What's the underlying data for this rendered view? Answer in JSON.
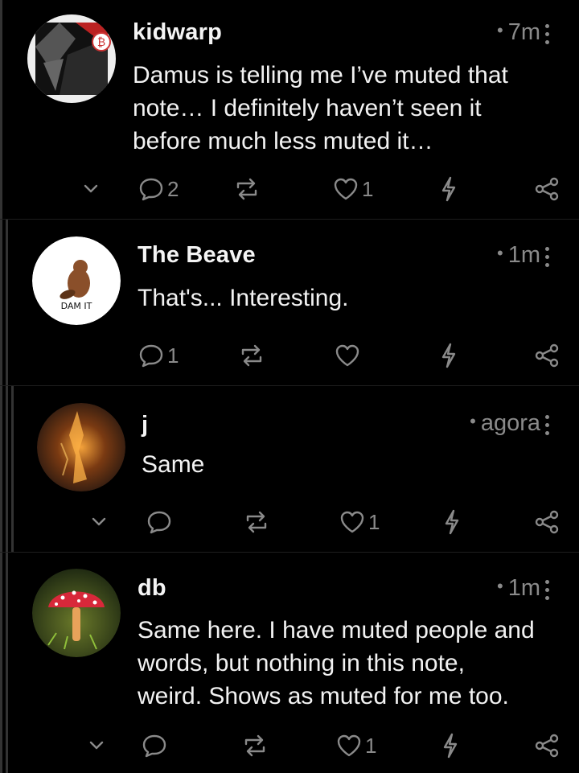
{
  "notes": [
    {
      "author": "kidwarp",
      "time": "7m",
      "dot": "•",
      "content_lines": [
        "Damus is telling me I’ve muted that",
        "note… I definitely haven’t seen it",
        "before much less muted it…"
      ],
      "replies": "2",
      "reposts": "",
      "likes": "1",
      "avatar_icon": "abstract-avatar-with-bitcoin-badge"
    },
    {
      "author": "The Beave",
      "time": "1m",
      "dot": "•",
      "content_lines": [
        "That's... Interesting."
      ],
      "replies": "1",
      "reposts": "",
      "likes": "",
      "avatar_icon": "beaver-logo",
      "avatar_text": "DAM IT"
    },
    {
      "author": "j",
      "time": "agora",
      "dot": "•",
      "content_lines": [
        "Same"
      ],
      "replies": "",
      "reposts": "",
      "likes": "1",
      "avatar_icon": "fire-avatar"
    },
    {
      "author": "db",
      "time": "1m",
      "dot": "•",
      "content_lines": [
        "Same here. I have muted people and",
        "words, but nothing in this note,",
        "weird. Shows as muted for me too."
      ],
      "replies": "",
      "reposts": "",
      "likes": "1",
      "avatar_icon": "mushroom-avatar"
    }
  ],
  "colors": {
    "background": "#000000",
    "text": "#f2f2f2",
    "muted": "#8a8a8a",
    "rail": "#333333"
  }
}
